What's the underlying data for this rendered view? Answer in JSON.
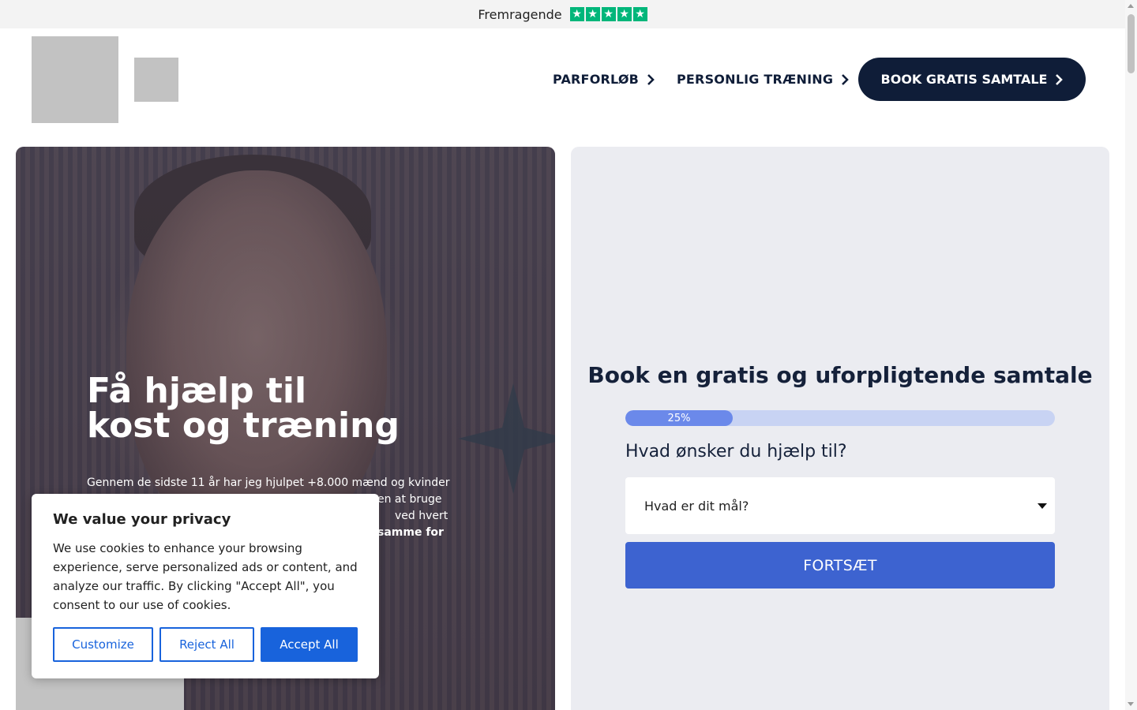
{
  "trustbar": {
    "label": "Fremragende",
    "star_icon": "star-icon",
    "star_count": 5,
    "star_color": "#00b67a"
  },
  "header": {
    "nav": [
      {
        "label": "PARFORLØB"
      },
      {
        "label": "PERSONLIG TRÆNING"
      }
    ],
    "cta_label": "BOOK GRATIS SAMTALE",
    "cta_color": "#0f1d38"
  },
  "hero": {
    "title_line1": "Få hjælp til",
    "title_line2": "kost og træning",
    "paragraph": "Gennem de sidste 11 år har jeg hjulpet +8.000 mænd og kvinder",
    "paragraph_fragment_1": "en at bruge",
    "paragraph_fragment_2": "ved hvert",
    "paragraph_fragment_bold": "samme for"
  },
  "form": {
    "title": "Book en gratis og uforpligtende samtale",
    "progress_percent": 25,
    "progress_label": "25%",
    "question": "Hvad ønsker du hjælp til?",
    "select_placeholder": "Hvad er dit mål?",
    "continue_label": "FORTSÆT",
    "button_color": "#3d63d0"
  },
  "cookie": {
    "title": "We value your privacy",
    "text": "We use cookies to enhance your browsing experience, serve personalized ads or content, and analyze our traffic. By clicking \"Accept All\", you consent to our use of cookies.",
    "customize_label": "Customize",
    "reject_label": "Reject All",
    "accept_label": "Accept All",
    "accent_color": "#1863dc"
  }
}
